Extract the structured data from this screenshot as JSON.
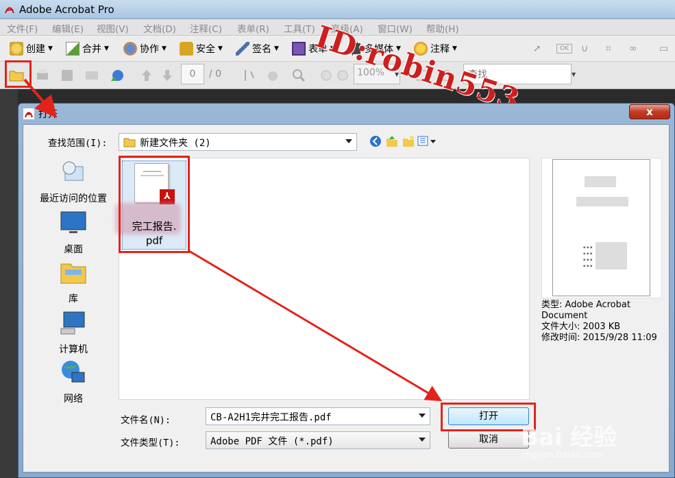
{
  "app": {
    "title": "Adobe Acrobat Pro"
  },
  "menu": [
    "文件(F)",
    "编辑(E)",
    "视图(V)",
    "文档(D)",
    "注释(C)",
    "表单(R)",
    "工具(T)",
    "高级(A)",
    "窗口(W)",
    "帮助(H)"
  ],
  "toolbar1": {
    "create": "创建",
    "combine": "合并",
    "collaborate": "协作",
    "secure": "安全",
    "sign": "签名",
    "forms": "表单",
    "multimedia": "多媒体",
    "comment": "注释"
  },
  "toolbar2": {
    "page_value": "0",
    "page_of": "/ 0",
    "zoom": "100%",
    "find_placeholder": "查找"
  },
  "watermark": "ID:robin553",
  "dialog": {
    "title": "打开",
    "close": "x",
    "look_in_label": "查找范围(I):",
    "look_in_value": "新建文件夹 (2)",
    "places": [
      "最近访问的位置",
      "桌面",
      "库",
      "计算机",
      "网络"
    ],
    "file": {
      "name_line1": "完工报告.",
      "name_line2": "pdf"
    },
    "info": {
      "type_label": "类型:",
      "type_value": "Adobe Acrobat Document",
      "size_label": "文件大小:",
      "size_value": "2003 KB",
      "modified_label": "修改时间:",
      "modified_value": "2015/9/28 11:09"
    },
    "filename_label": "文件名(N):",
    "filename_value": "CB-A2H1完井完工报告.pdf",
    "filetype_label": "文件类型(T):",
    "filetype_value": "Adobe PDF 文件 (*.pdf)",
    "open_button": "打开",
    "cancel_button": "取消"
  },
  "brand": {
    "logo": "Bai 经验",
    "url": "jingyan.baidu.com"
  },
  "colors": {
    "highlight": "#e2231a",
    "titlebar": "#aac6e3",
    "dialog_frame": "#8aa9cc"
  }
}
